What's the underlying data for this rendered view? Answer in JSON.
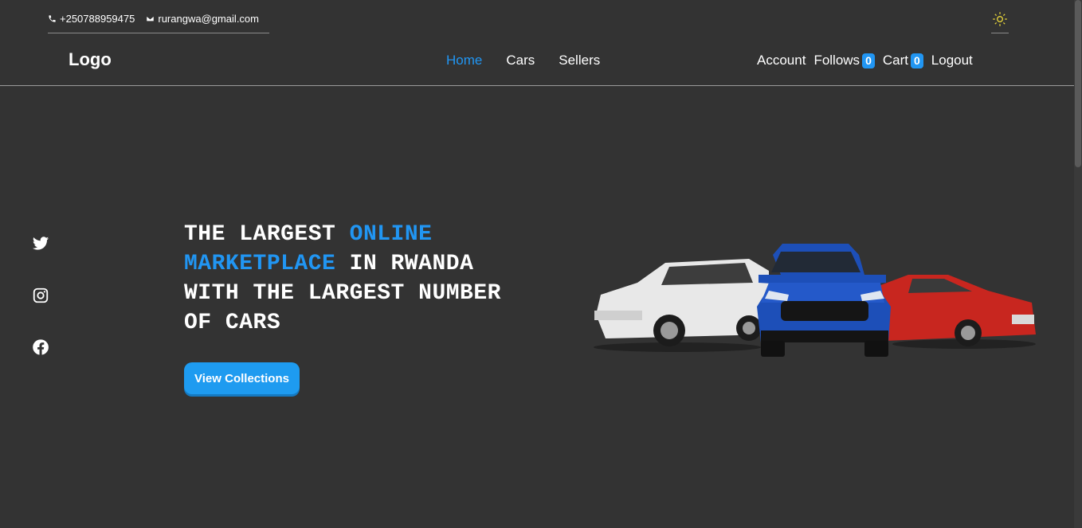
{
  "topbar": {
    "phone": "+250788959475",
    "email": "rurangwa@gmail.com"
  },
  "theme_toggle_icon": "sun-icon",
  "nav": {
    "logo": "Logo",
    "links": [
      {
        "label": "Home",
        "active": true
      },
      {
        "label": "Cars",
        "active": false
      },
      {
        "label": "Sellers",
        "active": false
      }
    ],
    "account": "Account",
    "follows": "Follows",
    "follows_count": "0",
    "cart": "Cart",
    "cart_count": "0",
    "logout": "Logout"
  },
  "social": [
    "twitter-icon",
    "instagram-icon",
    "facebook-icon"
  ],
  "hero": {
    "title_1": "THE LARGEST ",
    "title_hl_1": "ONLINE",
    "title_hl_2": "MARKETPLACE",
    "title_2": " IN RWANDA WITH THE LARGEST NUMBER OF CARS",
    "cta": "View Collections"
  },
  "colors": {
    "background": "#333333",
    "accent": "#2196f3",
    "button": "#1e9bf0"
  }
}
